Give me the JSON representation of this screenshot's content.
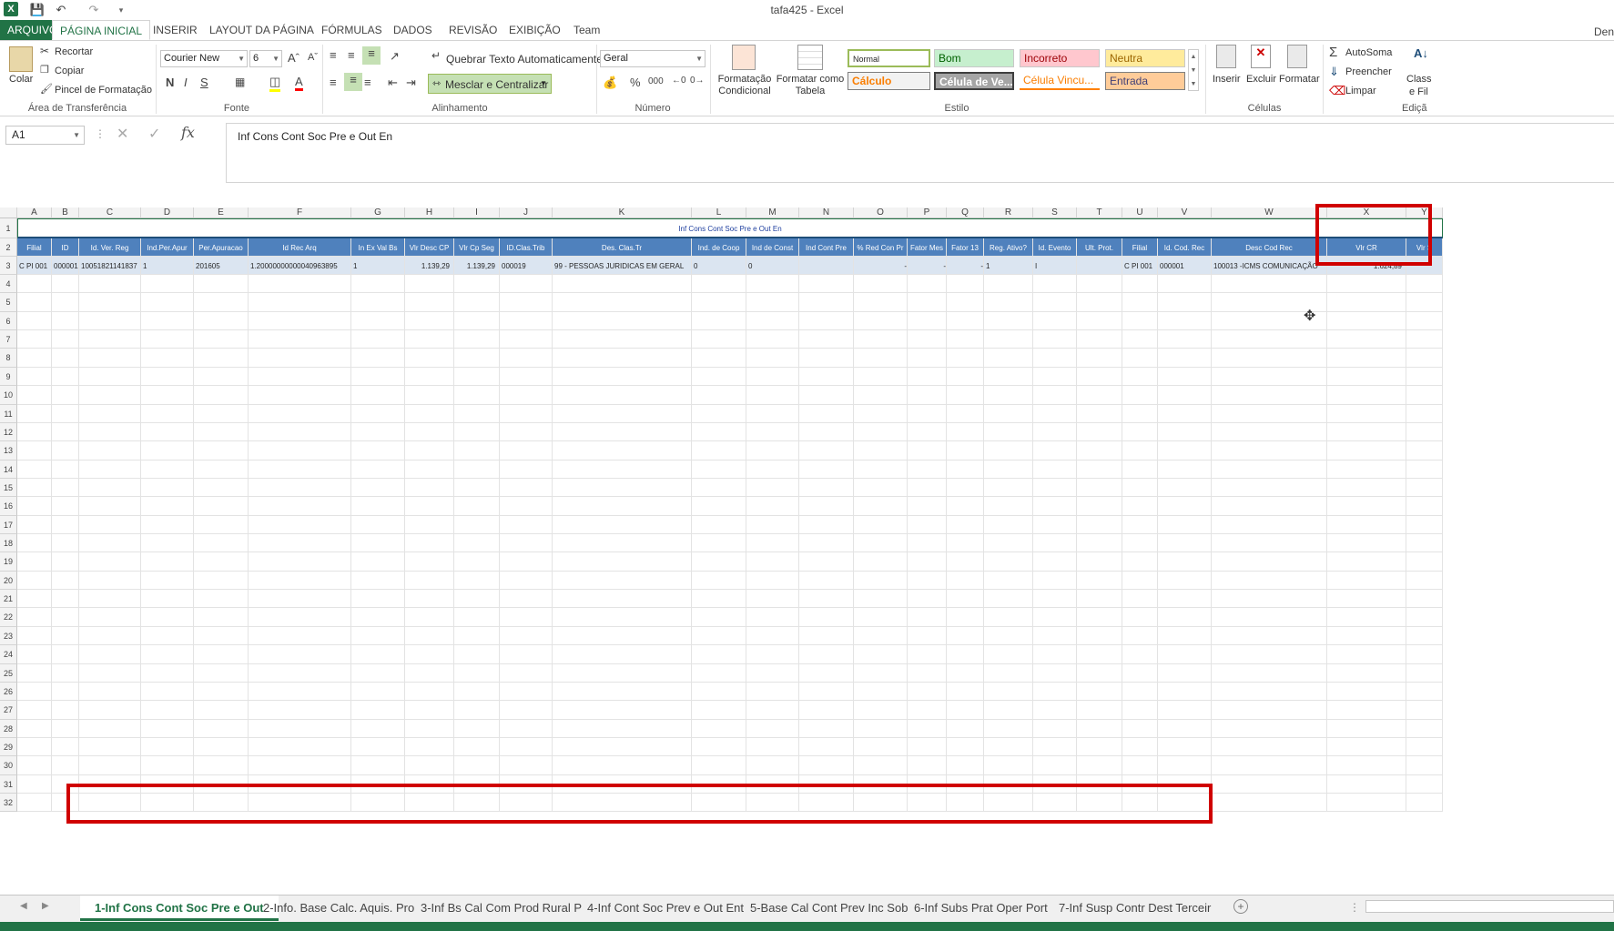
{
  "window": {
    "title": "tafa425 - Excel",
    "user": "Den"
  },
  "menu": [
    "ARQUIVO",
    "PÁGINA INICIAL",
    "INSERIR",
    "LAYOUT DA PÁGINA",
    "FÓRMULAS",
    "DADOS",
    "REVISÃO",
    "EXIBIÇÃO",
    "Team"
  ],
  "ribbon": {
    "clipboard": {
      "paste": "Colar",
      "cut": "Recortar",
      "copy": "Copiar",
      "painter": "Pincel de Formatação",
      "label": "Área de Transferência"
    },
    "font": {
      "name": "Courier New",
      "size": "6",
      "bold": "N",
      "italic": "I",
      "underline": "S",
      "label": "Fonte"
    },
    "align": {
      "wrap": "Quebrar Texto Automaticamente",
      "merge": "Mesclar e Centralizar",
      "label": "Alinhamento"
    },
    "number": {
      "format": "Geral",
      "label": "Número",
      "percent": "%",
      "thousands": "000"
    },
    "styles": {
      "cond": "Formatação Condicional",
      "table": "Formatar como Tabela",
      "label": "Estilo",
      "cells": [
        "Normal",
        "Bom",
        "Incorreto",
        "Neutra",
        "Cálculo",
        "Célula de Ve...",
        "Célula Vincu...",
        "Entrada"
      ]
    },
    "cellsgrp": {
      "insert": "Inserir",
      "delete": "Excluir",
      "format": "Formatar",
      "label": "Células"
    },
    "edit": {
      "autosum": "AutoSoma",
      "fill": "Preencher",
      "clear": "Limpar",
      "sort1": "Class",
      "sort2": "e Fil",
      "label": "Ediçã"
    }
  },
  "formula": {
    "namebox": "A1",
    "content": "Inf Cons Cont Soc Pre e Out En"
  },
  "columns": [
    "A",
    "B",
    "C",
    "D",
    "E",
    "F",
    "G",
    "H",
    "I",
    "J",
    "K",
    "L",
    "M",
    "N",
    "O",
    "P",
    "Q",
    "R",
    "S",
    "T",
    "U",
    "V",
    "W",
    "X",
    "Y"
  ],
  "row1": "Inf Cons Cont Soc Pre e Out En",
  "headers": [
    "Filial",
    "ID",
    "Id. Ver. Reg",
    "Ind.Per.Apur",
    "Per.Apuracao",
    "Id Rec Arq",
    "In Ex Val Bs",
    "Vlr Desc CP",
    "Vlr Cp Seg",
    "ID.Clas.Trib",
    "Des. Clas.Tr",
    "Ind. de Coop",
    "Ind de Const",
    "Ind Cont Pre",
    "% Red Con Pr",
    "Fator Mes",
    "Fator 13",
    "Reg. Ativo?",
    "Id. Evento",
    "Ult. Prot.",
    "Filial",
    "Id. Cod. Rec",
    "Desc Cod Rec",
    "Vlr CR",
    "Vlr S"
  ],
  "row3": [
    "C PI 001",
    "000001",
    "10051821141837",
    "1",
    "201605",
    "1.20000000000040963895",
    "1",
    "1.139,29",
    "1.139,29",
    "000019",
    "99 - PESSOAS JURIDICAS EM GERAL",
    "0",
    "0",
    "",
    "-",
    "-",
    "-",
    "1",
    "I",
    "",
    "C PI 001",
    "000001",
    "100013  -ICMS COMUNICAÇÃO",
    "1.624,89",
    ""
  ],
  "row_numbers": [
    "1",
    "2",
    "3",
    "4",
    "5",
    "6",
    "7",
    "8",
    "9",
    "10",
    "11",
    "12",
    "13",
    "14",
    "15",
    "16",
    "17",
    "18",
    "19",
    "20",
    "21",
    "22",
    "23",
    "24",
    "25",
    "26",
    "27",
    "28",
    "29",
    "30",
    "31",
    "32"
  ],
  "sheets": [
    "1-Inf Cons Cont Soc Pre e Out",
    "2-Info. Base Calc. Aquis. Pro",
    "3-Inf Bs Cal Com Prod Rural P",
    "4-Inf Cont Soc Prev e Out Ent",
    "5-Base Cal Cont Prev Inc Sob",
    "6-Inf Subs Prat Oper Port",
    "7-Inf Susp Contr Dest Terceir"
  ]
}
